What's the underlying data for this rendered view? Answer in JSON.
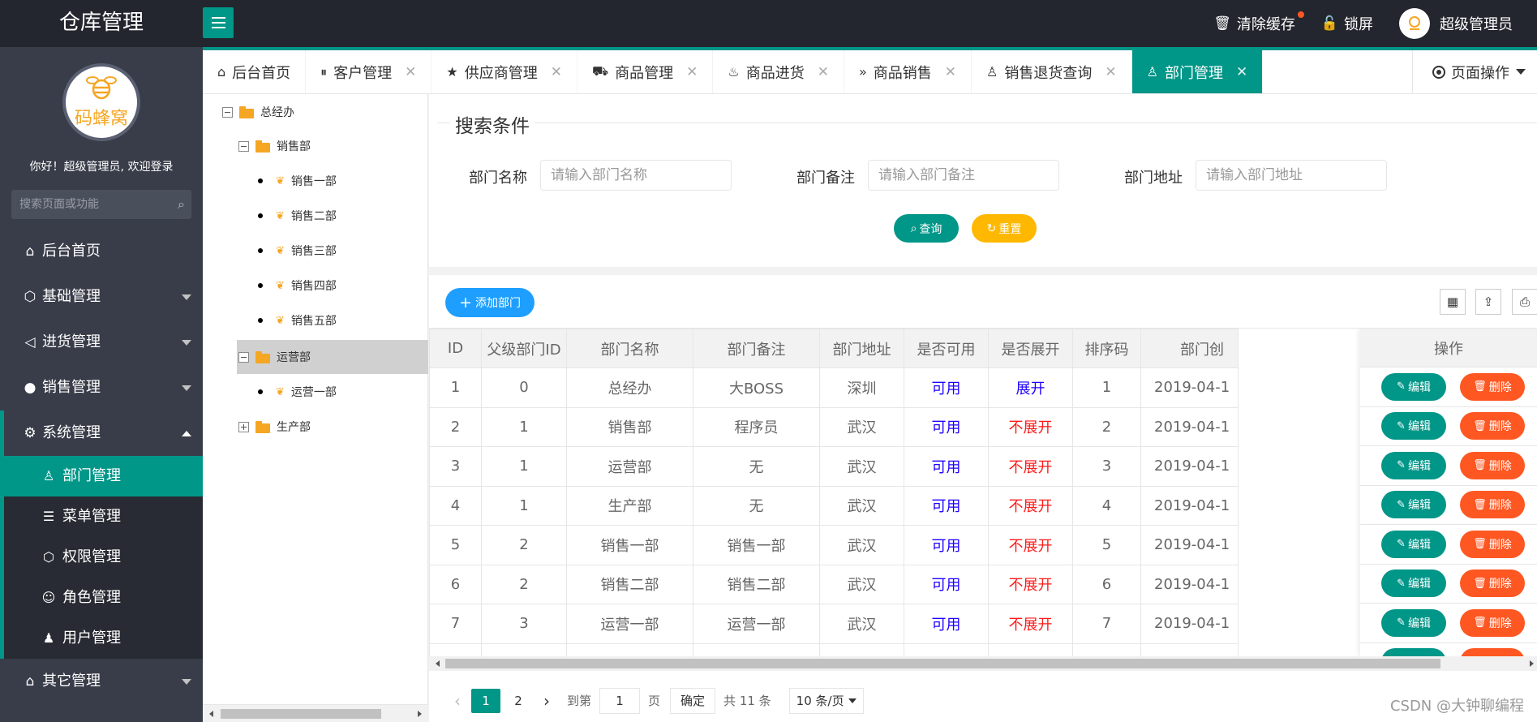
{
  "header": {
    "app_title": "仓库管理",
    "clear_cache": "清除缓存",
    "lock_screen": "锁屏",
    "user_name": "超级管理员"
  },
  "sidebar": {
    "brand_text": "码蜂窝",
    "welcome": "你好！超级管理员, 欢迎登录",
    "search_placeholder": "搜索页面或功能",
    "items": [
      {
        "label": "后台首页",
        "icon": "home-icon"
      },
      {
        "label": "基础管理",
        "icon": "cube-icon"
      },
      {
        "label": "进货管理",
        "icon": "speaker-icon"
      },
      {
        "label": "销售管理",
        "icon": "chat-icon"
      },
      {
        "label": "系统管理",
        "icon": "gear-icon"
      }
    ],
    "sub_items": [
      {
        "label": "部门管理",
        "icon": "user-icon"
      },
      {
        "label": "菜单管理",
        "icon": "menu-icon"
      },
      {
        "label": "权限管理",
        "icon": "cube-icon"
      },
      {
        "label": "角色管理",
        "icon": "smile-icon"
      },
      {
        "label": "用户管理",
        "icon": "person-icon"
      }
    ],
    "other": {
      "label": "其它管理",
      "icon": "home-icon"
    }
  },
  "tabs": [
    {
      "label": "后台首页",
      "icon": "home-icon"
    },
    {
      "label": "客户管理",
      "icon": "pause-icon"
    },
    {
      "label": "供应商管理",
      "icon": "star-icon"
    },
    {
      "label": "商品管理",
      "icon": "cart-icon"
    },
    {
      "label": "商品进货",
      "icon": "fire-icon"
    },
    {
      "label": "商品销售",
      "icon": "forward-icon"
    },
    {
      "label": "销售退货查询",
      "icon": "user-icon"
    },
    {
      "label": "部门管理",
      "icon": "user-icon"
    }
  ],
  "page_ops": "页面操作",
  "tree": {
    "root": "总经办",
    "sales": "销售部",
    "sales_children": [
      "销售一部",
      "销售二部",
      "销售三部",
      "销售四部",
      "销售五部"
    ],
    "ops": "运营部",
    "ops_children": [
      "运营一部"
    ],
    "production": "生产部"
  },
  "search": {
    "legend": "搜索条件",
    "name_label": "部门名称",
    "name_placeholder": "请输入部门名称",
    "remark_label": "部门备注",
    "remark_placeholder": "请输入部门备注",
    "address_label": "部门地址",
    "address_placeholder": "请输入部门地址",
    "query": "查询",
    "reset": "重置"
  },
  "table": {
    "add_button": "添加部门",
    "columns": [
      "ID",
      "父级部门ID",
      "部门名称",
      "部门备注",
      "部门地址",
      "是否可用",
      "是否展开",
      "排序码",
      "部门创"
    ],
    "ops_header": "操作",
    "edit": "编辑",
    "delete": "删除",
    "rows": [
      [
        "1",
        "0",
        "总经办",
        "大BOSS",
        "深圳",
        "可用",
        "展开",
        "1",
        "2019-04-1"
      ],
      [
        "2",
        "1",
        "销售部",
        "程序员",
        "武汉",
        "可用",
        "不展开",
        "2",
        "2019-04-1"
      ],
      [
        "3",
        "1",
        "运营部",
        "无",
        "武汉",
        "可用",
        "不展开",
        "3",
        "2019-04-1"
      ],
      [
        "4",
        "1",
        "生产部",
        "无",
        "武汉",
        "可用",
        "不展开",
        "4",
        "2019-04-1"
      ],
      [
        "5",
        "2",
        "销售一部",
        "销售一部",
        "武汉",
        "可用",
        "不展开",
        "5",
        "2019-04-1"
      ],
      [
        "6",
        "2",
        "销售二部",
        "销售二部",
        "武汉",
        "可用",
        "不展开",
        "6",
        "2019-04-1"
      ],
      [
        "7",
        "3",
        "运营一部",
        "运营一部",
        "武汉",
        "可用",
        "不展开",
        "7",
        "2019-04-1"
      ]
    ]
  },
  "pager": {
    "pages": [
      "1",
      "2"
    ],
    "goto": "到第",
    "page_value": "1",
    "page_unit": "页",
    "confirm": "确定",
    "total": "共 11 条",
    "per_page": "10 条/页"
  },
  "watermark": "CSDN @大钟聊编程",
  "colors": {
    "accent": "#009688",
    "warn": "#ffb800",
    "danger": "#ff5722",
    "blue": "#1e9fff",
    "dark": "#23262e"
  }
}
